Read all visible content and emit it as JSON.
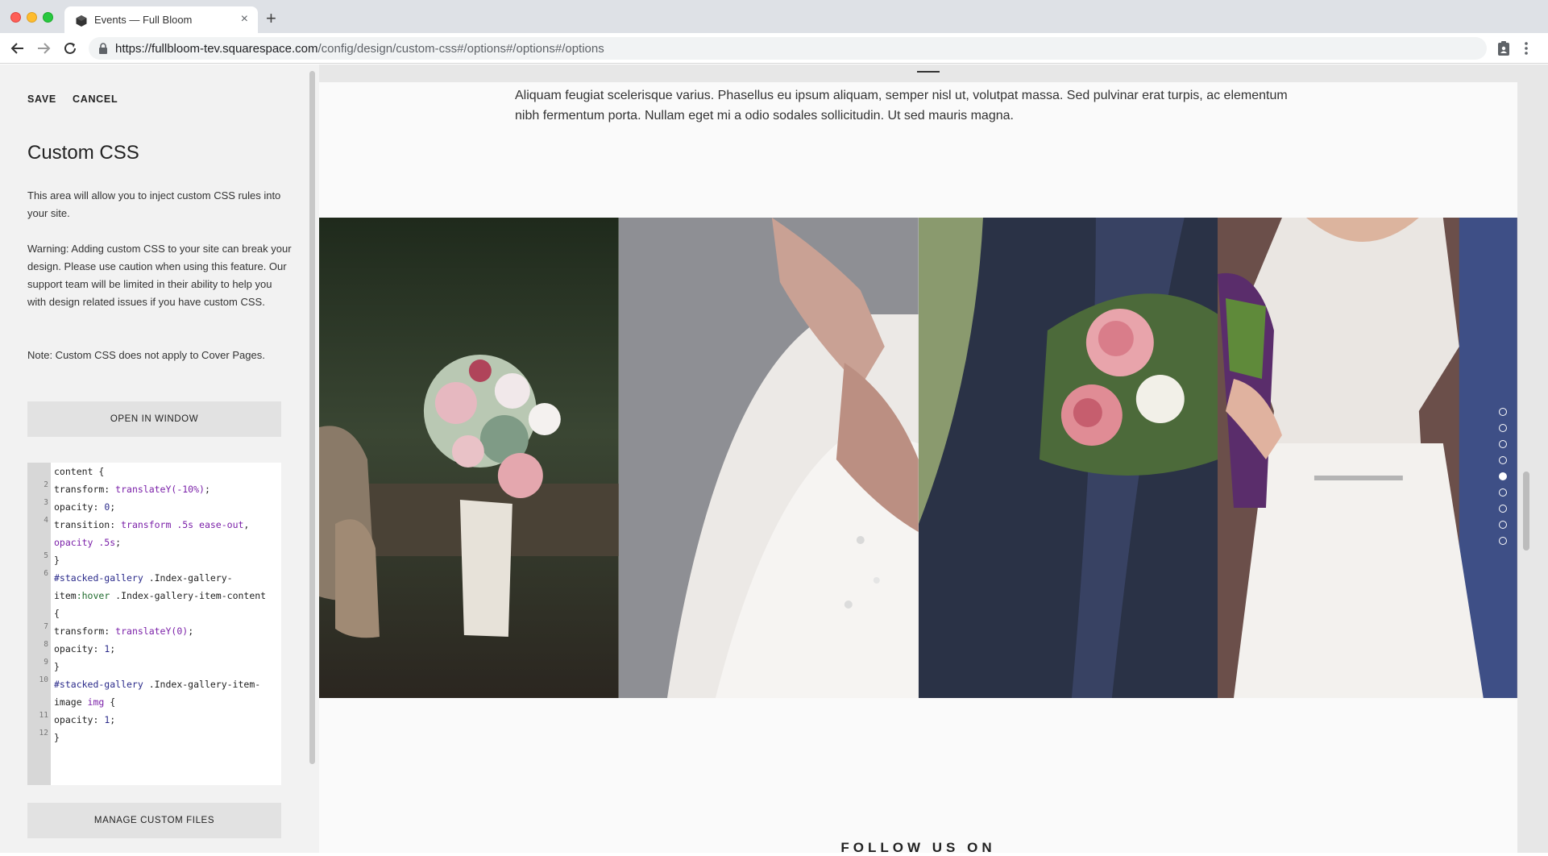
{
  "browser": {
    "tab_title": "Events — Full Bloom",
    "tab_close": "×",
    "new_tab": "+",
    "url_host": "https://fullbloom-tev.squarespace.com",
    "url_path": "/config/design/custom-css#/options#/options#/options"
  },
  "panel": {
    "save_label": "SAVE",
    "cancel_label": "CANCEL",
    "title": "Custom CSS",
    "intro": "This area will allow you to inject custom CSS rules into your site.",
    "warning": "Warning: Adding custom CSS to your site can break your design. Please use caution when using this feature. Our support team will be limited in their ability to help you with design related issues if you have custom CSS.",
    "note": "Note: Custom CSS does not apply to Cover Pages.",
    "open_window_label": "OPEN IN WINDOW",
    "manage_files_label": "MANAGE CUSTOM FILES",
    "line_numbers": [
      "2",
      "3",
      "4",
      "5",
      "6",
      "7",
      "8",
      "9",
      "10",
      "11",
      "12"
    ],
    "code": {
      "l1": "content {",
      "l2a": "  transform: ",
      "l2b": "translateY(-10%)",
      "l2c": ";",
      "l3a": "  opacity: ",
      "l3b": "0",
      "l3c": ";",
      "l4a": "  transition: ",
      "l4b": "transform .5s ease-out",
      "l4c": ",",
      "l5a": "opacity .5s",
      "l5b": ";",
      "l6": "}",
      "l7a": "#stacked-gallery",
      "l7b": " .Index-gallery-",
      "l8a": "item",
      "l8b": ":hover",
      "l8c": " .Index-gallery-item-content",
      "l9": "{",
      "l10a": "  transform: ",
      "l10b": "translateY(0)",
      "l10c": ";",
      "l11a": "  opacity: ",
      "l11b": "1",
      "l11c": ";",
      "l12": "}",
      "l13a": "#stacked-gallery",
      "l13b": " .Index-gallery-item-",
      "l14a": "image ",
      "l14b": "img",
      "l14c": " {",
      "l15a": "  opacity: ",
      "l15b": "1",
      "l15c": ";",
      "l16": "}"
    }
  },
  "preview": {
    "intro_text": "Aliquam feugiat scelerisque varius. Phasellus eu ipsum aliquam, semper nisl ut, volutpat massa. Sed pulvinar erat turpis, ac elementum nibh fermentum porta. Nullam eget mi a odio sodales sollicitudin. Ut sed mauris magna.",
    "follow_heading": "FOLLOW US ON",
    "active_slide_index": 4,
    "slide_count": 9
  },
  "colors": {
    "panel_bg": "#f2f2f2",
    "button_bg": "#e2e2e2",
    "code_keyword": "#7a1fa8",
    "code_selector": "#2a2a8a"
  }
}
